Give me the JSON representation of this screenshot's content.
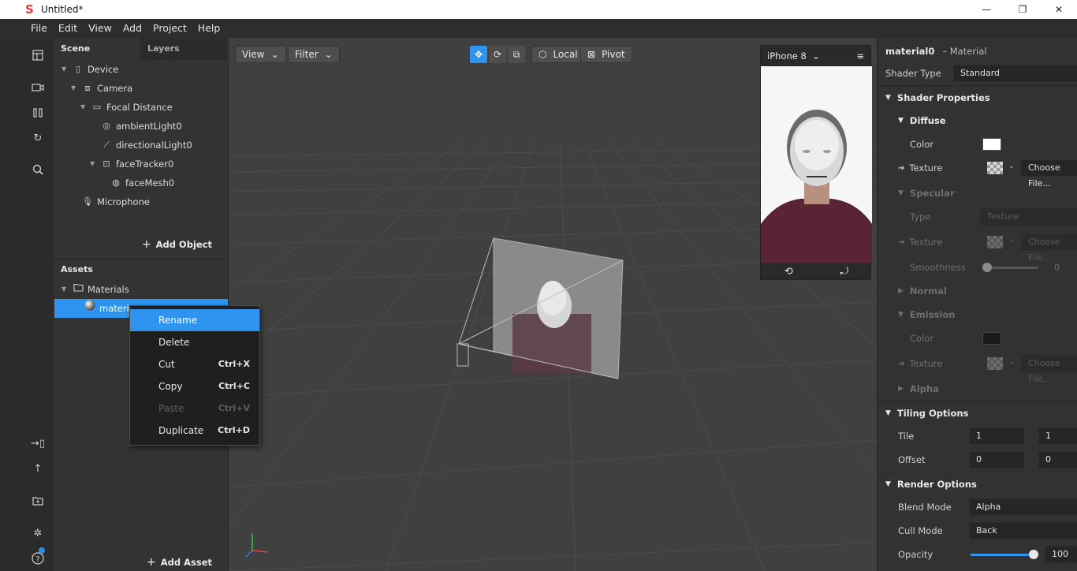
{
  "window": {
    "title": "Untitled*",
    "controls": [
      "—",
      "❐",
      "✕"
    ]
  },
  "menu": [
    "File",
    "Edit",
    "View",
    "Add",
    "Project",
    "Help"
  ],
  "left_toolbar": [
    "layout-icon",
    "video-icon",
    "pause-icon",
    "sync-icon",
    "search-icon",
    "import-icon",
    "upload-icon",
    "add-folder-icon",
    "bug-icon",
    "help-icon"
  ],
  "scene": {
    "tabs": [
      "Scene",
      "Layers"
    ],
    "tree": [
      {
        "label": "Device",
        "icon": "▯",
        "depth": 0,
        "expanded": true
      },
      {
        "label": "Camera",
        "icon": "⧈",
        "depth": 1,
        "expanded": true
      },
      {
        "label": "Focal Distance",
        "icon": "▭",
        "depth": 2,
        "expanded": true
      },
      {
        "label": "ambientLight0",
        "icon": "◎",
        "depth": 3,
        "expanded": null
      },
      {
        "label": "directionalLight0",
        "icon": "⟋",
        "depth": 3,
        "expanded": null
      },
      {
        "label": "faceTracker0",
        "icon": "⊡",
        "depth": 3,
        "expanded": true
      },
      {
        "label": "faceMesh0",
        "icon": "◍",
        "depth": 4,
        "expanded": null
      },
      {
        "label": "Microphone",
        "icon": "🎙",
        "depth": 1,
        "expanded": null
      }
    ],
    "add_label": "Add Object"
  },
  "assets": {
    "header": "Assets",
    "folder": "Materials",
    "item": "materia",
    "add_label": "Add Asset"
  },
  "context_menu": [
    {
      "label": "Rename",
      "shortcut": "",
      "state": "highlighted"
    },
    {
      "label": "Delete",
      "shortcut": "",
      "state": "normal"
    },
    {
      "label": "Cut",
      "shortcut": "Ctrl+X",
      "state": "normal"
    },
    {
      "label": "Copy",
      "shortcut": "Ctrl+C",
      "state": "normal"
    },
    {
      "label": "Paste",
      "shortcut": "Ctrl+V",
      "state": "disabled"
    },
    {
      "label": "Duplicate",
      "shortcut": "Ctrl+D",
      "state": "normal"
    }
  ],
  "viewport": {
    "view_label": "View",
    "filter_label": "Filter",
    "local_label": "Local",
    "pivot_label": "Pivot"
  },
  "simulator": {
    "device": "iPhone 8"
  },
  "inspector": {
    "title": "material0",
    "subtitle": "– Material",
    "shader_type_label": "Shader Type",
    "shader_type_value": "Standard",
    "shader_properties": "Shader Properties",
    "diffuse": "Diffuse",
    "color_label": "Color",
    "texture_label": "Texture",
    "choose_file": "Choose File...",
    "specular": "Specular",
    "type_label": "Type",
    "type_value": "Texture",
    "smoothness_label": "Smoothness",
    "smoothness_value": "0",
    "normal": "Normal",
    "emission": "Emission",
    "alpha": "Alpha",
    "tiling_options": "Tiling Options",
    "tile_label": "Tile",
    "tile_x": "1",
    "tile_y": "1",
    "offset_label": "Offset",
    "offset_x": "0",
    "offset_y": "0",
    "render_options": "Render Options",
    "blend_mode_label": "Blend Mode",
    "blend_mode_value": "Alpha",
    "cull_mode_label": "Cull Mode",
    "cull_mode_value": "Back",
    "opacity_label": "Opacity",
    "opacity_value": "100",
    "opacity_fraction": 1.0
  },
  "colors": {
    "accent": "#2f93f0",
    "panel": "#333333",
    "viewport": "#404040"
  }
}
